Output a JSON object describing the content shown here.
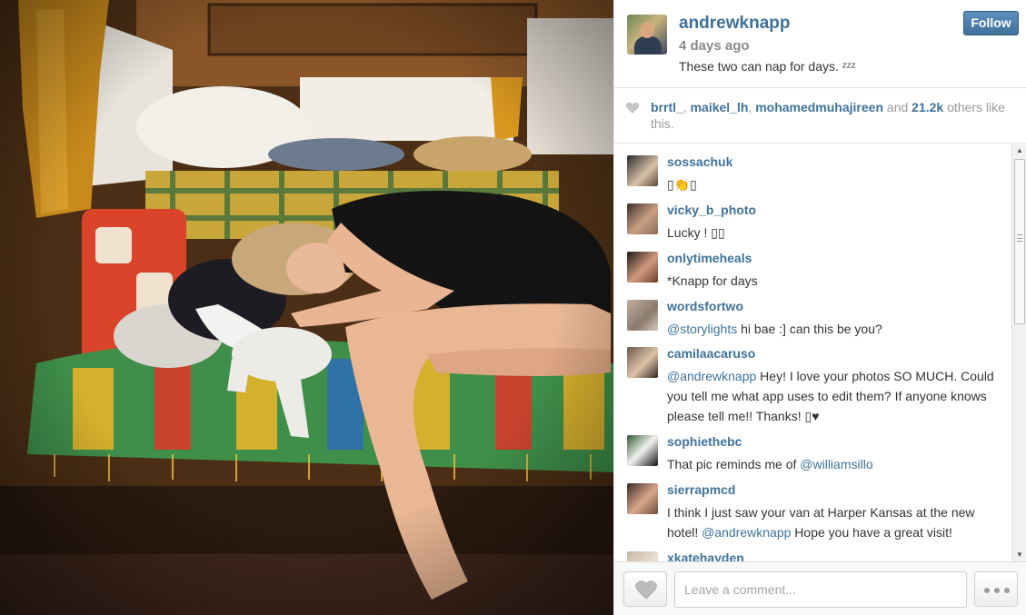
{
  "post": {
    "username": "andrewknapp",
    "time": "4 days ago",
    "caption": "These two can nap for days. ᶻᶻᶻ",
    "follow_label": "Follow"
  },
  "likes": {
    "user1": "brrtl_",
    "sep1": ", ",
    "user2": "maikel_lh",
    "sep2": ", ",
    "user3": "mohamedmuhajireen",
    "and": " and ",
    "count": "21.2k",
    "rest": " others like this."
  },
  "comments": [
    {
      "user": "sossachuk",
      "parts": [
        {
          "t": "▯👏▯",
          "m": false
        }
      ]
    },
    {
      "user": "vicky_b_photo",
      "parts": [
        {
          "t": "Lucky ! ▯▯",
          "m": false
        }
      ]
    },
    {
      "user": "onlytimeheals",
      "parts": [
        {
          "t": "*Knapp for days",
          "m": false
        }
      ]
    },
    {
      "user": "wordsfortwo",
      "parts": [
        {
          "t": "@storylights",
          "m": true
        },
        {
          "t": " hi bae :] can this be you?",
          "m": false
        }
      ]
    },
    {
      "user": "camilaacaruso",
      "parts": [
        {
          "t": "@andrewknapp",
          "m": true
        },
        {
          "t": " Hey! I love your photos SO MUCH. Could you tell me what app uses to edit them? If anyone knows please tell me!! Thanks! ▯♥",
          "m": false
        }
      ]
    },
    {
      "user": "sophiethebc",
      "parts": [
        {
          "t": "That pic reminds me of ",
          "m": false
        },
        {
          "t": "@williamsillo",
          "m": true
        }
      ]
    },
    {
      "user": "sierrapmcd",
      "parts": [
        {
          "t": "I think I just saw your van at Harper Kansas at the new hotel! ",
          "m": false
        },
        {
          "t": "@andrewknapp",
          "m": true
        },
        {
          "t": " Hope you have a great visit!",
          "m": false
        }
      ]
    },
    {
      "user": "xkatehayden",
      "parts": []
    }
  ],
  "comment_box": {
    "placeholder": "Leave a comment..."
  },
  "colors": {
    "link": "#3f729b",
    "follow_bg": "#3f729b",
    "muted": "#999999"
  },
  "icons": {
    "like": "heart-icon",
    "more": "ellipsis-icon"
  }
}
